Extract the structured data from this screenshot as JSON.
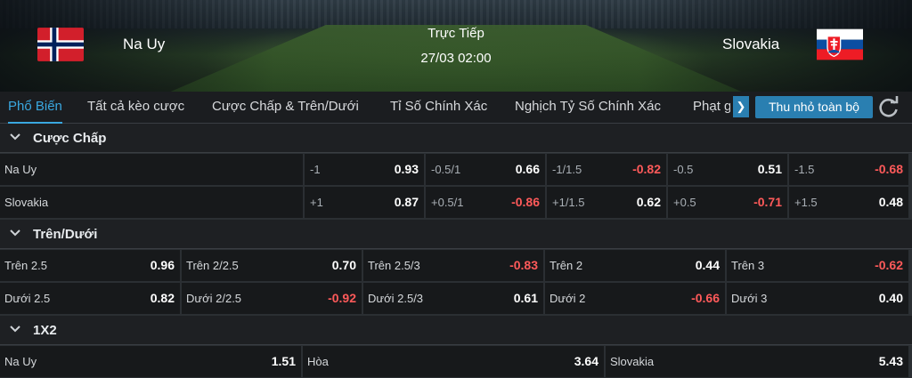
{
  "header": {
    "home_team": "Na Uy",
    "away_team": "Slovakia",
    "status": "Trực Tiếp",
    "datetime": "27/03 02:00",
    "flag_home_icon": "norway-flag-icon",
    "flag_away_icon": "slovakia-flag-icon"
  },
  "tabs": [
    "Phổ Biến",
    "Tất cả kèo cược",
    "Cược Chấp & Trên/Dưới",
    "Tỉ Số Chính Xác",
    "Nghịch Tỷ Số Chính Xác",
    "Phạt góc"
  ],
  "active_tab": "Phổ Biến",
  "toolbar": {
    "next_icon": "chevron-right-icon",
    "collapse_label": "Thu nhỏ toàn bộ",
    "refresh_icon": "refresh-icon"
  },
  "sections": {
    "handicap": {
      "title": "Cược Chấp",
      "rows": [
        {
          "team": "Na Uy",
          "cells": [
            [
              "-1",
              "0.93"
            ],
            [
              "-0.5/1",
              "0.66"
            ],
            [
              "-1/1.5",
              "-0.82"
            ],
            [
              "-0.5",
              "0.51"
            ],
            [
              "-1.5",
              "-0.68"
            ]
          ]
        },
        {
          "team": "Slovakia",
          "cells": [
            [
              "+1",
              "0.87"
            ],
            [
              "+0.5/1",
              "-0.86"
            ],
            [
              "+1/1.5",
              "0.62"
            ],
            [
              "+0.5",
              "-0.71"
            ],
            [
              "+1.5",
              "0.48"
            ]
          ]
        }
      ]
    },
    "overunder": {
      "title": "Trên/Dưới",
      "rows": [
        [
          [
            "Trên 2.5",
            "0.96"
          ],
          [
            "Trên 2/2.5",
            "0.70"
          ],
          [
            "Trên 2.5/3",
            "-0.83"
          ],
          [
            "Trên 2",
            "0.44"
          ],
          [
            "Trên 3",
            "-0.62"
          ]
        ],
        [
          [
            "Dưới 2.5",
            "0.82"
          ],
          [
            "Dưới 2/2.5",
            "-0.92"
          ],
          [
            "Dưới 2.5/3",
            "0.61"
          ],
          [
            "Dưới 2",
            "-0.66"
          ],
          [
            "Dưới 3",
            "0.40"
          ]
        ]
      ]
    },
    "onextwo": {
      "title": "1X2",
      "cells": [
        [
          "Na Uy",
          "1.51"
        ],
        [
          "Hòa",
          "3.64"
        ],
        [
          "Slovakia",
          "5.43"
        ]
      ]
    }
  },
  "colors": {
    "accent": "#3aa8e0",
    "negative": "#ff5a5a",
    "button": "#2a7fb1"
  }
}
